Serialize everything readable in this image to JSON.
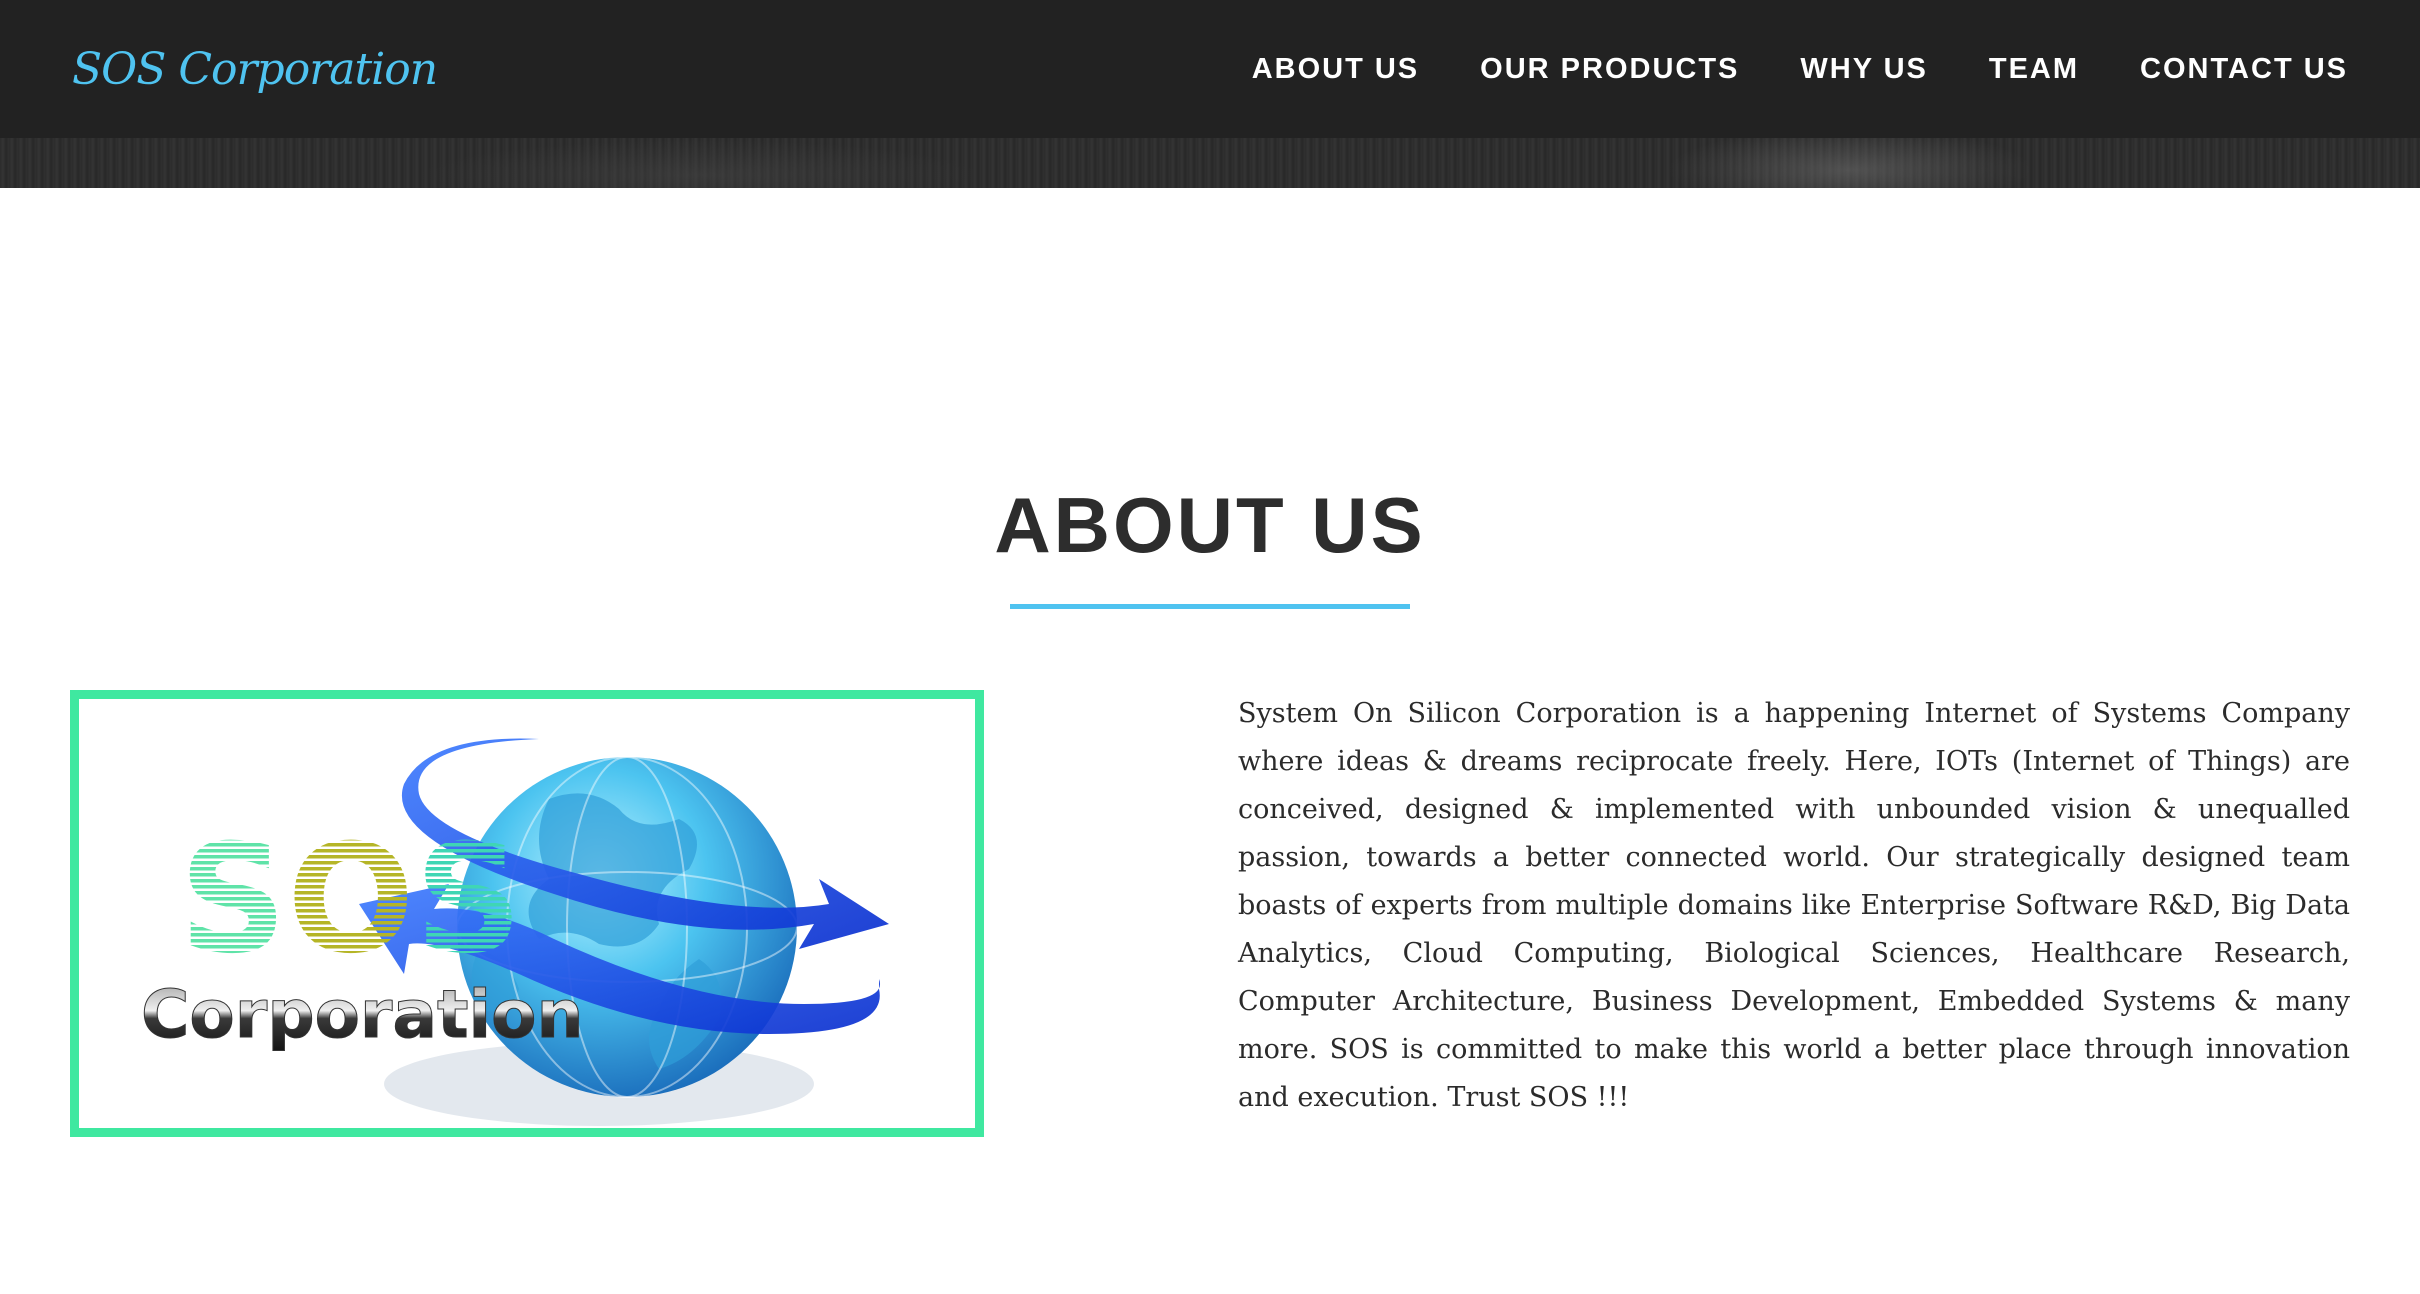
{
  "navbar": {
    "brand": "SOS Corporation",
    "links": [
      {
        "label": "ABOUT US"
      },
      {
        "label": "OUR PRODUCTS"
      },
      {
        "label": "WHY US"
      },
      {
        "label": "TEAM"
      },
      {
        "label": "CONTACT US"
      }
    ]
  },
  "about": {
    "title": "ABOUT US",
    "logo": {
      "word_top": "SOS",
      "word_bottom": "Corporation"
    },
    "body": "System On Silicon Corporation is a happening Internet of Systems Company where ideas & dreams reciprocate freely. Here, IOTs (Internet of Things) are conceived, designed & implemented with unbounded vision & unequalled passion, towards a better connected world. Our strategically designed team boasts of experts from multiple domains like Enterprise Software R&D, Big Data Analytics, Cloud Computing, Biological Sciences, Healthcare Research, Computer Architecture, Business Development, Embedded Systems & many more. SOS is committed to make this world a better place through innovation and execution. Trust SOS !!!"
  },
  "colors": {
    "navbar_bg": "#222222",
    "brand": "#4fc3f0",
    "accent_underline": "#4fc3f0",
    "logo_border": "#3fe8a0"
  },
  "icons": [
    "globe-icon",
    "circular-arrows-icon"
  ]
}
